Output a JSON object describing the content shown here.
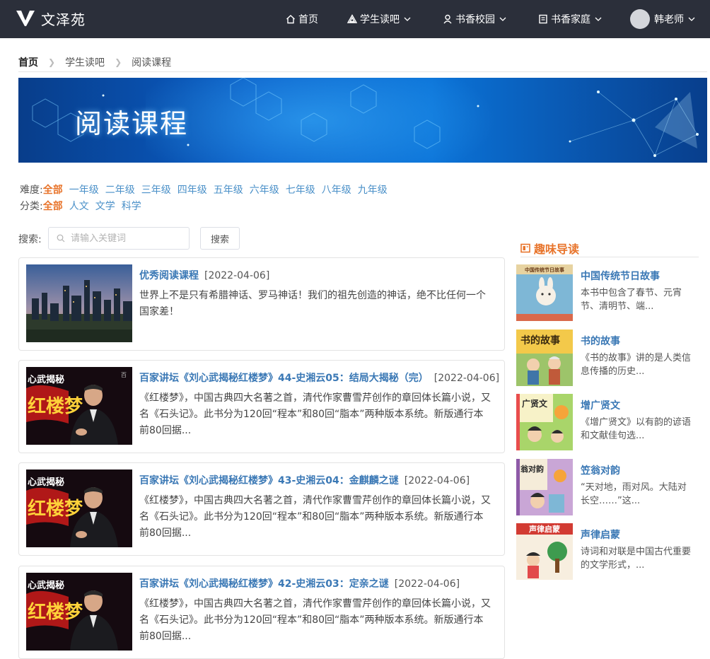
{
  "nav": {
    "brand": "文泽苑",
    "items": [
      {
        "label": "首页"
      },
      {
        "label": "学生读吧"
      },
      {
        "label": "书香校园"
      },
      {
        "label": "书香家庭"
      }
    ],
    "user": "韩老师"
  },
  "breadcrumb": [
    "首页",
    "学生读吧",
    "阅读课程"
  ],
  "banner": {
    "title": "阅读课程"
  },
  "filters": {
    "difficulty": {
      "label": "难度:",
      "options": [
        "全部",
        "一年级",
        "二年级",
        "三年级",
        "四年级",
        "五年级",
        "六年级",
        "七年级",
        "八年级",
        "九年级"
      ],
      "selected": "全部"
    },
    "category": {
      "label": "分类:",
      "options": [
        "全部",
        "人文",
        "文学",
        "科学"
      ],
      "selected": "全部"
    }
  },
  "search": {
    "label": "搜索:",
    "placeholder": "请输入关键词",
    "button": "搜索"
  },
  "courses": [
    {
      "title": "优秀阅读课程",
      "date": "[2022-04-06]",
      "desc": "世界上不是只有希腊神话、罗马神话！我们的祖先创造的神话，绝不比任何一个国家差！",
      "thumb": "city-skyline"
    },
    {
      "title": "百家讲坛《刘心武揭秘红楼梦》44-史湘云05：结局大揭秘（完）",
      "date": "[2022-04-06]",
      "desc": "《红楼梦》，中国古典四大名著之首，清代作家曹雪芹创作的章回体长篇小说，又名《石头记》。此书分为120回“程本”和80回“脂本”两种版本系统。新版通行本前80回据...",
      "thumb": "lecture"
    },
    {
      "title": "百家讲坛《刘心武揭秘红楼梦》43-史湘云04：金麒麟之谜",
      "date": "[2022-04-06]",
      "desc": "《红楼梦》，中国古典四大名著之首，清代作家曹雪芹创作的章回体长篇小说，又名《石头记》。此书分为120回“程本”和80回“脂本”两种版本系统。新版通行本前80回据...",
      "thumb": "lecture"
    },
    {
      "title": "百家讲坛《刘心武揭秘红楼梦》42-史湘云03：定亲之谜",
      "date": "[2022-04-06]",
      "desc": "《红楼梦》，中国古典四大名著之首，清代作家曹雪芹创作的章回体长篇小说，又名《石头记》。此书分为120回“程本”和80回“脂本”两种版本系统。新版通行本前80回据...",
      "thumb": "lecture"
    }
  ],
  "sidebar": {
    "heading": "趣味导读",
    "books": [
      {
        "title": "中国传统节日故事",
        "desc": "本书中包含了春节、元宵节、清明节、端...",
        "cover_text": "中国传统节日故事"
      },
      {
        "title": "书的故事",
        "desc": "《书的故事》讲的是人类信息传播的历史...",
        "cover_text": "书的故事"
      },
      {
        "title": "增广贤文",
        "desc": "《增广贤文》以有韵的谚语和文献佳句选...",
        "cover_text": "广贤文"
      },
      {
        "title": "笠翁对韵",
        "desc": "“天对地，雨对风。大陆对长空……”这...",
        "cover_text": "翁对韵"
      },
      {
        "title": "声律启蒙",
        "desc": "诗词和对联是中国古代重要的文学形式，...",
        "cover_text": "声律启蒙"
      }
    ]
  },
  "colors": {
    "accent": "#e8742b",
    "link": "#3a78b5",
    "nav_bg": "#2b2f3a"
  }
}
